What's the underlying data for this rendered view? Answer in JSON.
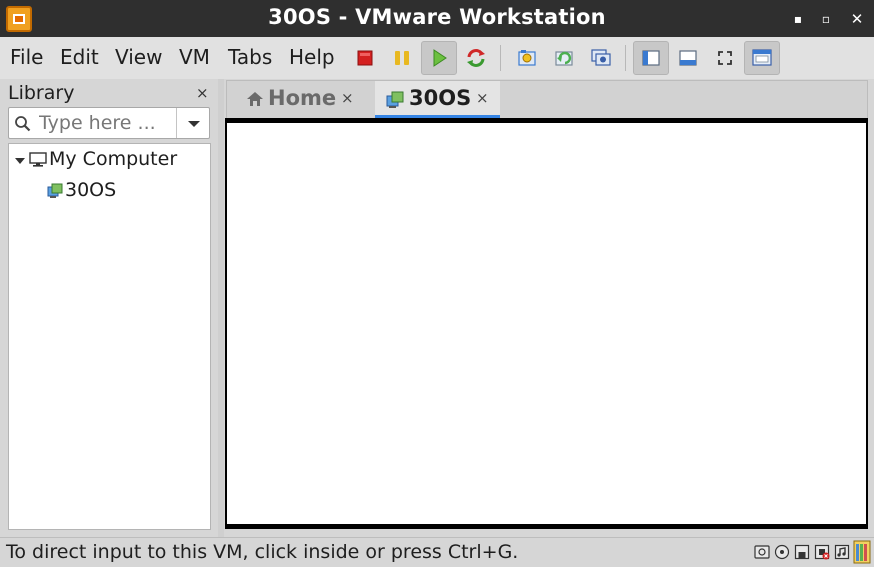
{
  "window": {
    "title": "30OS - VMware Workstation",
    "minimize_glyph": "▪",
    "maximize_glyph": "▫",
    "close_glyph": "✕"
  },
  "menu": {
    "file": "File",
    "edit": "Edit",
    "view": "View",
    "vm": "VM",
    "tabs": "Tabs",
    "help": "Help"
  },
  "toolbar": {
    "buttons": [
      {
        "name": "power-off-icon",
        "color": "#d42020"
      },
      {
        "name": "suspend-icon",
        "color": "#e8b820"
      },
      {
        "name": "power-on-icon",
        "color": "#6cc040"
      },
      {
        "name": "restart-icon",
        "color": "#d02828"
      },
      {
        "name": "take-snapshot-icon",
        "color": "#3a7ad0"
      },
      {
        "name": "revert-snapshot-icon",
        "color": "#4caf50"
      },
      {
        "name": "snapshot-manager-icon",
        "color": "#3a5fa8"
      },
      {
        "name": "show-library-icon",
        "pressed": true
      },
      {
        "name": "show-thumbnail-bar-icon"
      },
      {
        "name": "full-screen-icon"
      },
      {
        "name": "unity-console-view-icon",
        "pressed": true
      }
    ]
  },
  "library": {
    "title": "Library",
    "close_glyph": "×",
    "search_placeholder": "Type here ...",
    "tree": {
      "root_label": "My Computer",
      "vm_label": "30OS"
    }
  },
  "tabs": [
    {
      "label": "Home",
      "close_glyph": "×",
      "active": false
    },
    {
      "label": "30OS",
      "close_glyph": "×",
      "active": true
    }
  ],
  "status": {
    "message": "To direct input to this VM, click inside or press Ctrl+G.",
    "devices": [
      "hard-disk-icon",
      "cd-dvd-icon",
      "floppy-icon",
      "network-adapter-icon",
      "sound-card-icon",
      "message-log-icon"
    ]
  },
  "colors": {
    "titlebar": "#2f2f2f",
    "active_tab_underline": "#3584e4",
    "app_icon": "#f0a020"
  }
}
